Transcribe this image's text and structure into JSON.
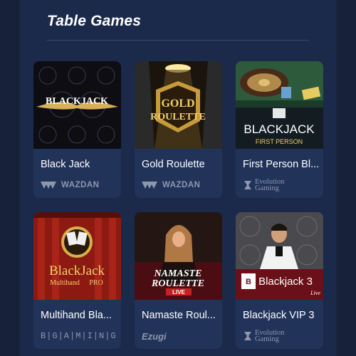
{
  "section": {
    "title": "Table Games"
  },
  "games": [
    {
      "title": "Black Jack",
      "thumb_text": "BLACKJACK",
      "provider": "WAZDAN",
      "provider_icon": "wazdan-logo-icon"
    },
    {
      "title": "Gold Roulette",
      "thumb_text_1": "GOLD",
      "thumb_text_2": "ROULETTE",
      "provider": "WAZDAN",
      "provider_icon": "wazdan-logo-icon"
    },
    {
      "title": "First Person Bl...",
      "thumb_text_1": "BLACKJACK",
      "thumb_text_2": "FIRST PERSON",
      "provider_1": "Evolution",
      "provider_2": "Gaming",
      "provider_icon": "evolution-logo-icon"
    },
    {
      "title": "Multihand Bla...",
      "thumb_text_1": "BlackJack",
      "thumb_text_2": "Multihand",
      "thumb_text_3": "PRO",
      "provider": "B|G|A|M|I|N|G",
      "provider_icon": "bgaming-logo-icon"
    },
    {
      "title": "Namaste Roul...",
      "thumb_text_1": "NAMASTE",
      "thumb_text_2": "ROULETTE",
      "thumb_text_3": "LIVE",
      "provider": "Ezugi",
      "provider_icon": "ezugi-logo-icon"
    },
    {
      "title": "Blackjack VIP 3",
      "thumb_text_1": "Blackjack 3",
      "thumb_text_2": "Live",
      "provider_1": "Evolution",
      "provider_2": "Gaming",
      "provider_icon": "evolution-logo-icon"
    }
  ],
  "colors": {
    "background": "#17223a",
    "panel": "#1b2a4a",
    "card": "#22335a",
    "provider_text": "#8d97ad",
    "gold": "#d8b04a"
  }
}
